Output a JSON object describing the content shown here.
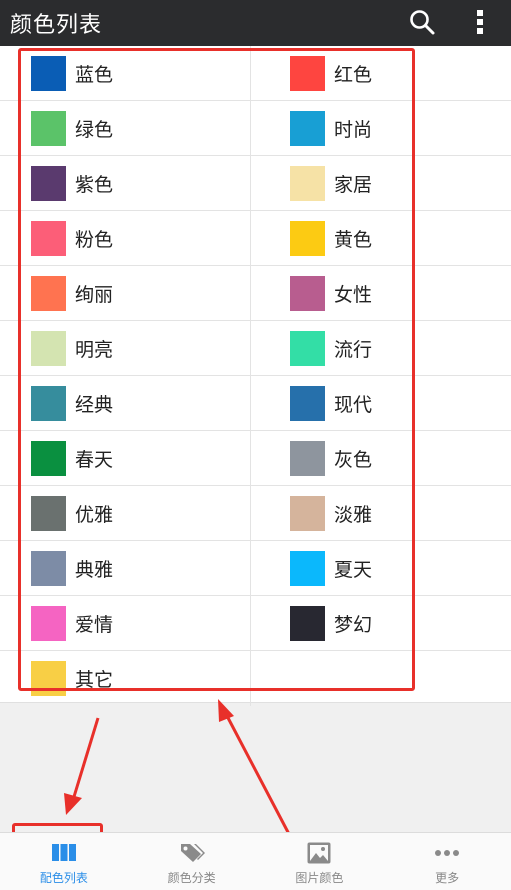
{
  "header": {
    "title": "颜色列表",
    "search_icon": "search-icon",
    "more_icon": "more-vert-icon"
  },
  "colors": {
    "left": [
      {
        "label": "蓝色",
        "color": "#0a5db5"
      },
      {
        "label": "绿色",
        "color": "#5bc369"
      },
      {
        "label": "紫色",
        "color": "#5a3a6e"
      },
      {
        "label": "粉色",
        "color": "#fc5e78"
      },
      {
        "label": "绚丽",
        "color": "#ff7350"
      },
      {
        "label": "明亮",
        "color": "#d4e4b1"
      },
      {
        "label": "经典",
        "color": "#368d9d"
      },
      {
        "label": "春天",
        "color": "#0a9040"
      },
      {
        "label": "优雅",
        "color": "#6a716f"
      },
      {
        "label": "典雅",
        "color": "#7d8ca6"
      },
      {
        "label": "爱情",
        "color": "#f564c2"
      },
      {
        "label": "其它",
        "color": "#f8cf45"
      }
    ],
    "right": [
      {
        "label": "红色",
        "color": "#fe4540"
      },
      {
        "label": "时尚",
        "color": "#189fd4"
      },
      {
        "label": "家居",
        "color": "#f6e2a6"
      },
      {
        "label": "黄色",
        "color": "#fccb13"
      },
      {
        "label": "女性",
        "color": "#b85d8f"
      },
      {
        "label": "流行",
        "color": "#33dea6"
      },
      {
        "label": "现代",
        "color": "#2670ab"
      },
      {
        "label": "灰色",
        "color": "#8e959e"
      },
      {
        "label": "淡雅",
        "color": "#d5b49c"
      },
      {
        "label": "夏天",
        "color": "#0bb8fc"
      },
      {
        "label": "梦幻",
        "color": "#282831"
      }
    ]
  },
  "annotation_color": "#e8302a",
  "nav": {
    "active_color": "#2a8ee8",
    "tabs": [
      {
        "label": "配色列表",
        "icon": "columns-icon"
      },
      {
        "label": "颜色分类",
        "icon": "tags-icon"
      },
      {
        "label": "图片颜色",
        "icon": "image-icon"
      },
      {
        "label": "更多",
        "icon": "more-horiz-icon"
      }
    ]
  }
}
